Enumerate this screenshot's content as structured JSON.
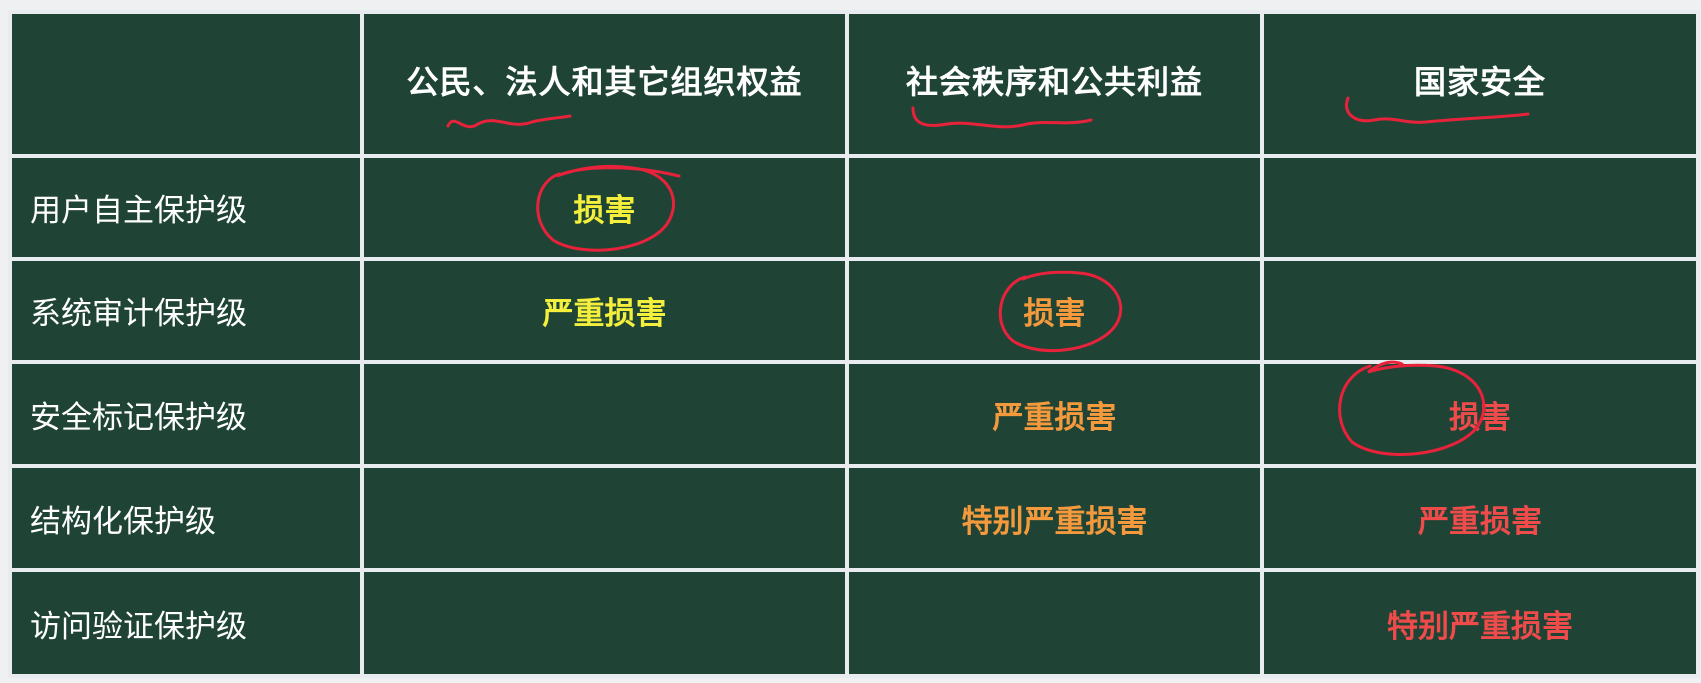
{
  "table": {
    "headers": [
      "",
      "公民、法人和其它组织权益",
      "社会秩序和公共利益",
      "国家安全"
    ],
    "rows": [
      {
        "label": "用户自主保护级",
        "cells": [
          "损害",
          "",
          ""
        ]
      },
      {
        "label": "系统审计保护级",
        "cells": [
          "严重损害",
          "损害",
          ""
        ]
      },
      {
        "label": "安全标记保护级",
        "cells": [
          "",
          "严重损害",
          "损害"
        ]
      },
      {
        "label": "结构化保护级",
        "cells": [
          "",
          "特别严重损害",
          "严重损害"
        ]
      },
      {
        "label": "访问验证保护级",
        "cells": [
          "",
          "",
          "特别严重损害"
        ]
      }
    ]
  },
  "colors": {
    "board": "#1f4436",
    "grid_lines": "#e9ecef",
    "header_text": "#ffffff",
    "column_1_values": "#f3ef3c",
    "column_2_values": "#f49a3c",
    "column_3_values": "#ef4b4b",
    "annotation_ink": "#e8223a"
  },
  "annotations": {
    "underlined_headers": [
      "公民、法人和其它组织权益",
      "社会秩序和公共利益",
      "国家安全"
    ],
    "circled_values": [
      "损害"
    ]
  }
}
